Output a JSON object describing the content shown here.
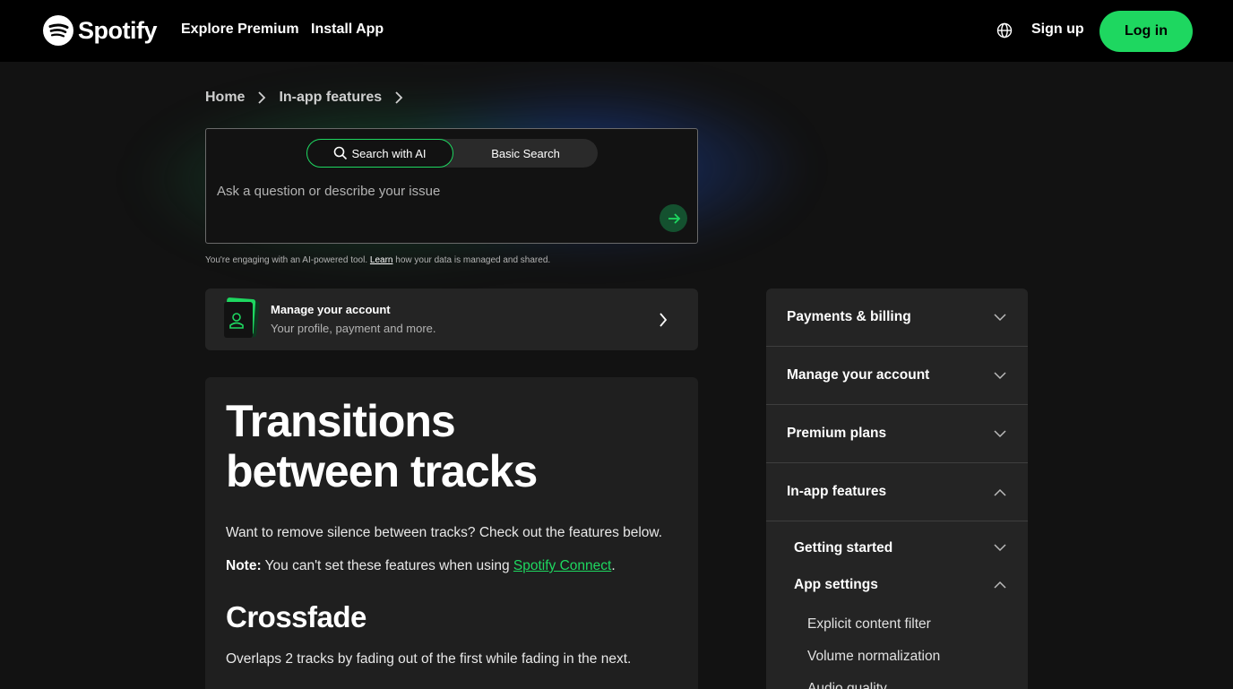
{
  "nav": {
    "logo_text": "Spotify",
    "explore_premium": "Explore Premium",
    "install_app": "Install App",
    "sign_up": "Sign up",
    "log_in": "Log in"
  },
  "breadcrumb": {
    "home": "Home",
    "current": "In-app features"
  },
  "search": {
    "ai_tab": "Search with AI",
    "basic_tab": "Basic Search",
    "placeholder": "Ask a question or describe your issue",
    "disclaimer_before": "You're engaging with an AI-powered tool.",
    "disclaimer_link": "Learn",
    "disclaimer_after": "how your data is managed and shared."
  },
  "manage_card": {
    "title": "Manage your account",
    "subtitle": "Your profile, payment and more."
  },
  "article": {
    "title_line1": "Transitions",
    "title_line2": "between tracks",
    "intro": "Want to remove silence between tracks? Check out the features below.",
    "note_label": "Note:",
    "note_text": "You can't set these features when using",
    "note_link": "Spotify Connect",
    "note_end": ".",
    "section_title": "Crossfade",
    "section_text": "Overlaps 2 tracks by fading out of the first while fading in the next."
  },
  "sidebar": {
    "items": [
      {
        "label": "Payments & billing",
        "expanded": false
      },
      {
        "label": "Manage your account",
        "expanded": false
      },
      {
        "label": "Premium plans",
        "expanded": false
      },
      {
        "label": "In-app features",
        "expanded": true
      }
    ],
    "sub_items": [
      {
        "label": "Getting started",
        "expanded": false
      },
      {
        "label": "App settings",
        "expanded": true
      }
    ],
    "leaves": [
      "Explicit content filter",
      "Volume normalization",
      "Audio quality"
    ]
  },
  "colors": {
    "brand_green": "#1ed760",
    "background": "#121212",
    "card": "#242424"
  }
}
